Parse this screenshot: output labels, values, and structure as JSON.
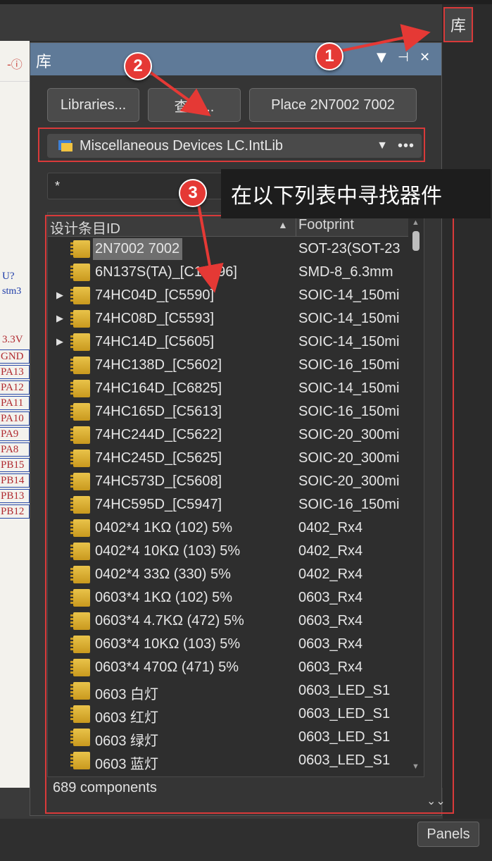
{
  "side_button": {
    "label": "库"
  },
  "schematic": {
    "labels": [
      "U?",
      "stm3",
      "3.3V"
    ],
    "nets": [
      "GND",
      "PA13",
      "PA12",
      "PA11",
      "PA10",
      "PA9",
      "PA8",
      "PB15",
      "PB14",
      "PB13",
      "PB12"
    ]
  },
  "panel": {
    "title": "库",
    "buttons": {
      "libraries": "Libraries...",
      "search": "查找...",
      "place": "Place 2N7002 7002"
    },
    "library_name": "Miscellaneous Devices LC.IntLib",
    "more": "•••",
    "filter_value": "*",
    "columns": {
      "id": "设计条目ID",
      "footprint": "Footprint"
    },
    "rows": [
      {
        "id": "2N7002 7002",
        "footprint": "SOT-23(SOT-23",
        "expandable": false,
        "selected": true
      },
      {
        "id": "6N137S(TA)_[C16496]",
        "footprint": "SMD-8_6.3mm",
        "expandable": false
      },
      {
        "id": "74HC04D_[C5590]",
        "footprint": "SOIC-14_150mi",
        "expandable": true
      },
      {
        "id": "74HC08D_[C5593]",
        "footprint": "SOIC-14_150mi",
        "expandable": true
      },
      {
        "id": "74HC14D_[C5605]",
        "footprint": "SOIC-14_150mi",
        "expandable": true
      },
      {
        "id": "74HC138D_[C5602]",
        "footprint": "SOIC-16_150mi",
        "expandable": false
      },
      {
        "id": "74HC164D_[C6825]",
        "footprint": "SOIC-14_150mi",
        "expandable": false
      },
      {
        "id": "74HC165D_[C5613]",
        "footprint": "SOIC-16_150mi",
        "expandable": false
      },
      {
        "id": "74HC244D_[C5622]",
        "footprint": "SOIC-20_300mi",
        "expandable": false
      },
      {
        "id": "74HC245D_[C5625]",
        "footprint": "SOIC-20_300mi",
        "expandable": false
      },
      {
        "id": "74HC573D_[C5608]",
        "footprint": "SOIC-20_300mi",
        "expandable": false
      },
      {
        "id": "74HC595D_[C5947]",
        "footprint": "SOIC-16_150mi",
        "expandable": false
      },
      {
        "id": "0402*4 1KΩ (102) 5%",
        "footprint": "0402_Rx4",
        "expandable": false
      },
      {
        "id": "0402*4 10KΩ (103) 5%",
        "footprint": "0402_Rx4",
        "expandable": false
      },
      {
        "id": "0402*4 33Ω (330) 5%",
        "footprint": "0402_Rx4",
        "expandable": false
      },
      {
        "id": "0603*4  1KΩ (102) 5%",
        "footprint": "0603_Rx4",
        "expandable": false
      },
      {
        "id": "0603*4  4.7KΩ (472) 5%",
        "footprint": "0603_Rx4",
        "expandable": false
      },
      {
        "id": "0603*4  10KΩ (103) 5%",
        "footprint": "0603_Rx4",
        "expandable": false
      },
      {
        "id": "0603*4 470Ω (471) 5%",
        "footprint": "0603_Rx4",
        "expandable": false
      },
      {
        "id": "0603 白灯",
        "footprint": "0603_LED_S1",
        "expandable": false
      },
      {
        "id": "0603 红灯",
        "footprint": "0603_LED_S1",
        "expandable": false
      },
      {
        "id": "0603 绿灯",
        "footprint": "0603_LED_S1",
        "expandable": false
      },
      {
        "id": "0603 蓝灯",
        "footprint": "0603_LED_S1",
        "expandable": false
      }
    ],
    "count_text": "689 components"
  },
  "annotations": {
    "badges": [
      "1",
      "2",
      "3"
    ],
    "tip": "在以下列表中寻找器件",
    "color": "#e53935"
  },
  "panels_button": "Panels"
}
